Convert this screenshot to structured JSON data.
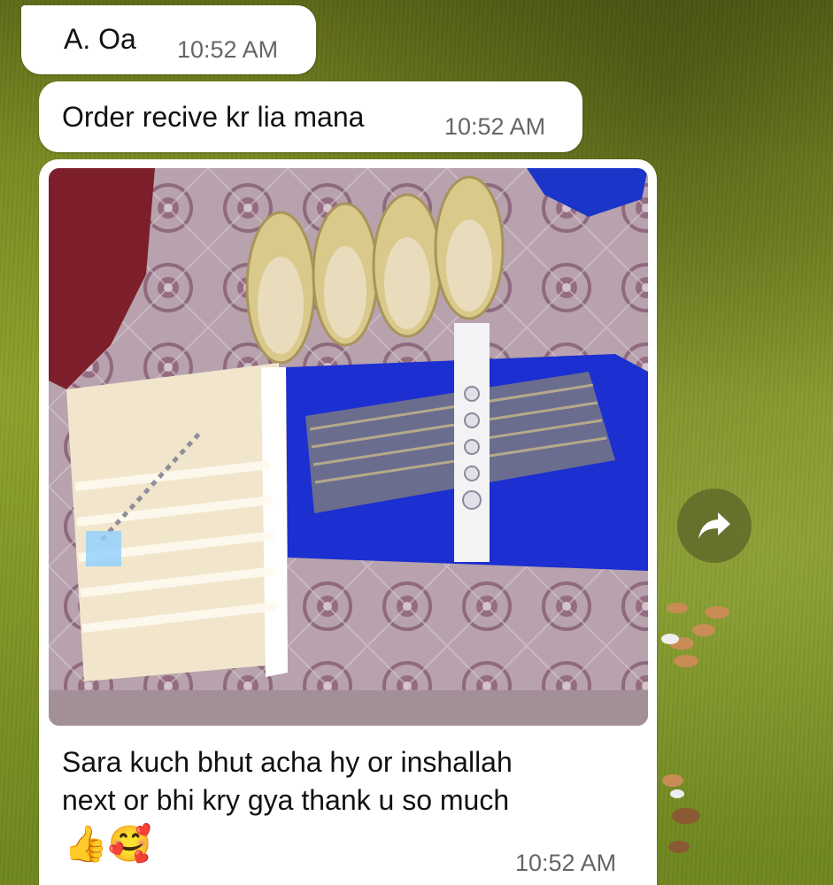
{
  "messages": [
    {
      "text": "A. Oa",
      "time": "10:52 AM"
    },
    {
      "text": "Order recive kr lia mana",
      "time": "10:52 AM"
    },
    {
      "caption_line1": "Sara kuch bhut acha hy or inshallah",
      "caption_line2": "next or bhi kry gya thank u so much",
      "emojis": "👍🥰",
      "time": "10:52 AM"
    }
  ],
  "icons": {
    "share": "forward-share-icon"
  },
  "colors": {
    "bubble": "#ffffff",
    "wallpaper": "#7f9526",
    "fabric_blue": "#1c2fd0",
    "fabric_cream": "#efe4c8"
  }
}
